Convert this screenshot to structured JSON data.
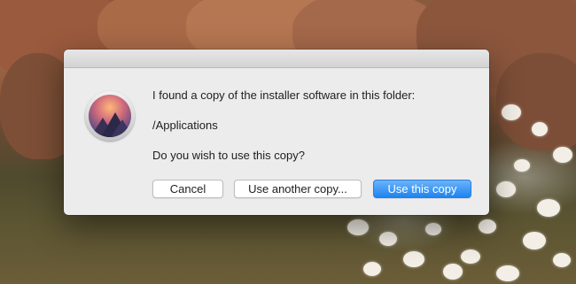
{
  "dialog": {
    "message": "I found a copy of the installer software in this folder:",
    "path": "/Applications",
    "question": "Do you wish to use this copy?",
    "icon": "macos-installer-icon",
    "buttons": {
      "cancel": "Cancel",
      "other": "Use another copy...",
      "primary": "Use this copy"
    }
  },
  "colors": {
    "primary_button": "#1d84f0",
    "dialog_background": "#ececec"
  }
}
